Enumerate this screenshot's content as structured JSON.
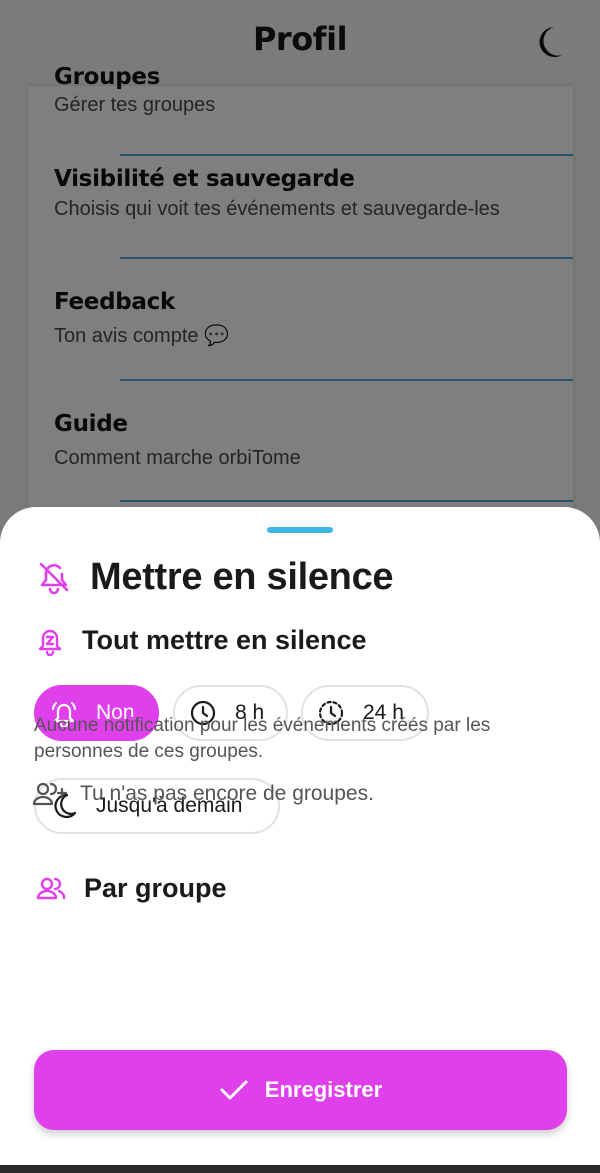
{
  "header": {
    "title": "Profil",
    "theme_icon": "moon-icon"
  },
  "menu": {
    "items": [
      {
        "title": "Groupes",
        "subtitle": "Gérer tes groupes"
      },
      {
        "title": "Visibilité et sauvegarde",
        "subtitle": "Choisis qui voit tes événements et sauvegarde-les"
      },
      {
        "title": "Feedback",
        "subtitle": "Ton avis compte 💬"
      },
      {
        "title": "Guide",
        "subtitle": "Comment marche orbiTome"
      }
    ]
  },
  "sheet": {
    "title": "Mettre en silence",
    "title_icon": "bell-off-icon",
    "mute_all": {
      "title": "Tout mettre en silence",
      "icon": "bell-snooze-icon",
      "options": [
        {
          "label": "Non",
          "icon": "bell-ring-icon",
          "selected": true
        },
        {
          "label": "8 h",
          "icon": "clock-icon",
          "selected": false
        },
        {
          "label": "24 h",
          "icon": "clock-dashed-icon",
          "selected": false
        },
        {
          "label": "Jusqu'à demain",
          "icon": "moon-icon",
          "selected": false
        }
      ]
    },
    "by_group": {
      "title": "Par groupe",
      "icon": "group-icon",
      "description": "Aucune notification pour les événements créés par les personnes de ces groupes.",
      "empty_text": "Tu n'as pas encore de groupes.",
      "empty_icon": "add-user-icon"
    },
    "save_label": "Enregistrer"
  },
  "colors": {
    "accent": "#e040ec",
    "divider": "#4aa7e0",
    "handle": "#3fb6e6"
  }
}
